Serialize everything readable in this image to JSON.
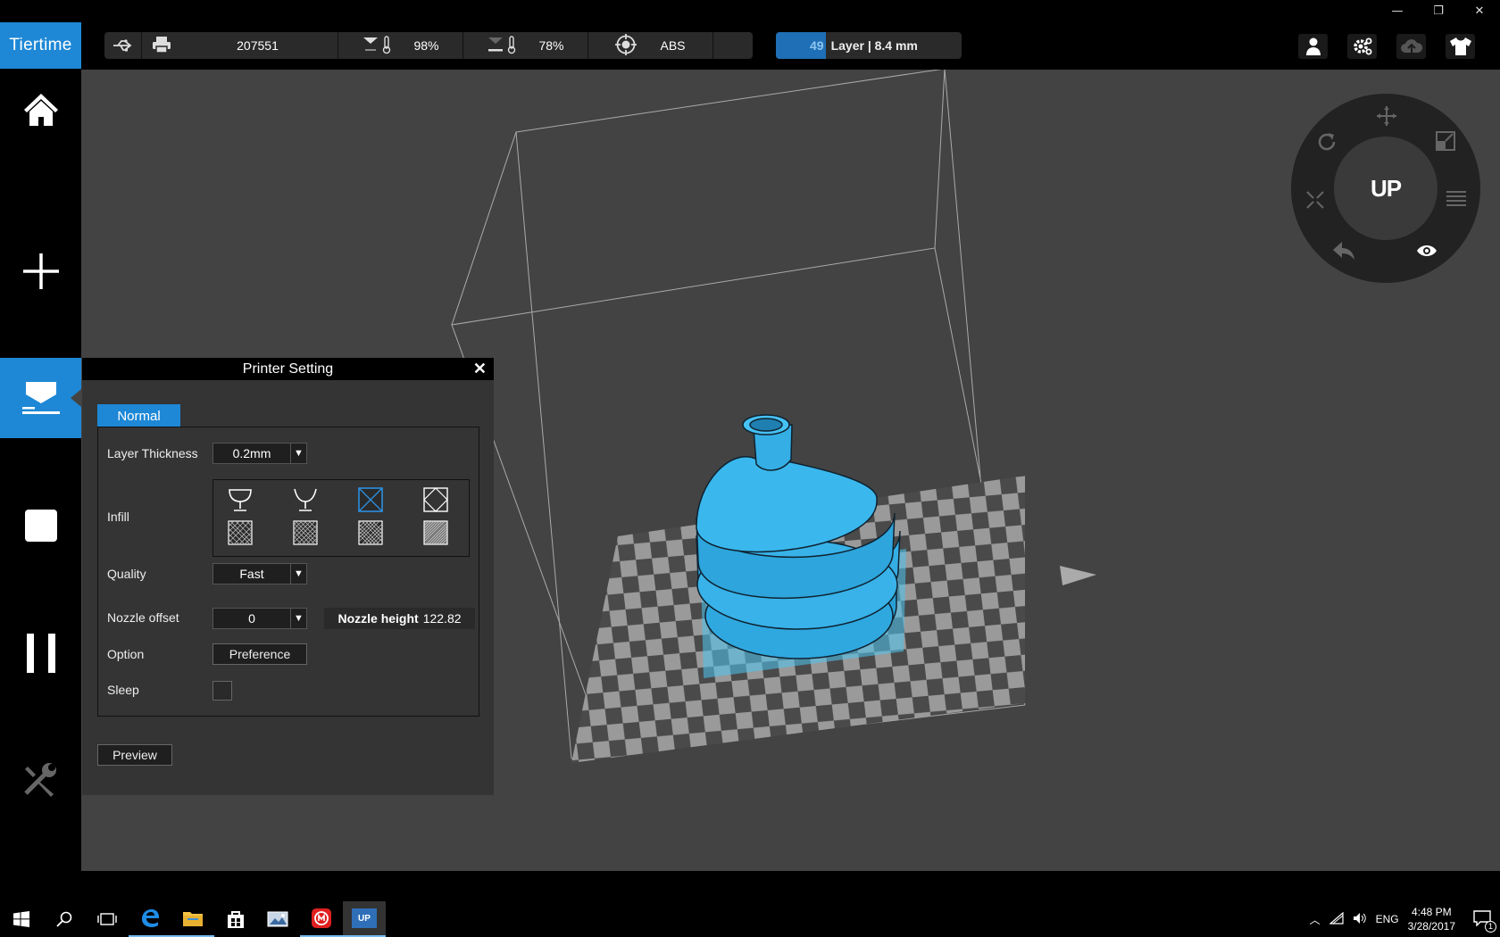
{
  "window": {
    "minimize_label": "—",
    "restore_label": "❐",
    "close_label": "✕"
  },
  "brand": {
    "logo_text": "Tiertime"
  },
  "status": {
    "serial": "207551",
    "nozzle_temp_pct": "98%",
    "bed_temp_pct": "78%",
    "material": "ABS",
    "icons": [
      "usb-icon",
      "printer-icon",
      "nozzle-temperature-icon",
      "bed-temperature-icon",
      "target-icon"
    ]
  },
  "layer": {
    "number": "49",
    "text": "Layer | 8.4 mm",
    "progress": 0.27
  },
  "top_icons": [
    "user-icon",
    "settings-gear-icon",
    "cloud-upload-icon",
    "tshirt-icon"
  ],
  "sidebar": {
    "items": [
      {
        "name": "home",
        "icon": "home-icon"
      },
      {
        "name": "add",
        "icon": "plus-icon"
      },
      {
        "name": "print",
        "icon": "print-setting-icon",
        "active": true
      },
      {
        "name": "stop",
        "icon": "stop-icon"
      },
      {
        "name": "pause",
        "icon": "pause-icon"
      },
      {
        "name": "maintenance",
        "icon": "tools-icon"
      }
    ]
  },
  "dial": {
    "center_label": "UP",
    "icons": [
      "move-icon",
      "scale-icon",
      "rotate-icon",
      "menu-icon",
      "autoplace-icon",
      "undo-icon",
      "view-eye-icon"
    ]
  },
  "panel": {
    "title": "Printer Setting",
    "close_label": "✕",
    "tab": "Normal",
    "layer_thickness": {
      "label": "Layer Thickness",
      "value": "0.2mm"
    },
    "infill": {
      "label": "Infill",
      "selected_index": 2
    },
    "quality": {
      "label": "Quality",
      "value": "Fast"
    },
    "nozzle_offset": {
      "label": "Nozzle offset",
      "value": "0"
    },
    "nozzle_height": {
      "label": "Nozzle height",
      "value": "122.82"
    },
    "option": {
      "label": "Option",
      "button": "Preference"
    },
    "sleep": {
      "label": "Sleep",
      "checked": false
    },
    "preview_button": "Preview"
  },
  "taskbar": {
    "apps": [
      "start-icon",
      "search-icon",
      "task-view-icon",
      "edge-icon",
      "file-explorer-icon",
      "store-icon",
      "photos-icon",
      "app-red-icon",
      "up-studio-icon"
    ],
    "up_label": "UP",
    "lang": "ENG",
    "time": "4:48 PM",
    "date": "3/28/2017",
    "notification_count": "1"
  },
  "colors": {
    "accent": "#1e88d6",
    "model": "#35aee5",
    "viewport_bg": "#434343"
  }
}
